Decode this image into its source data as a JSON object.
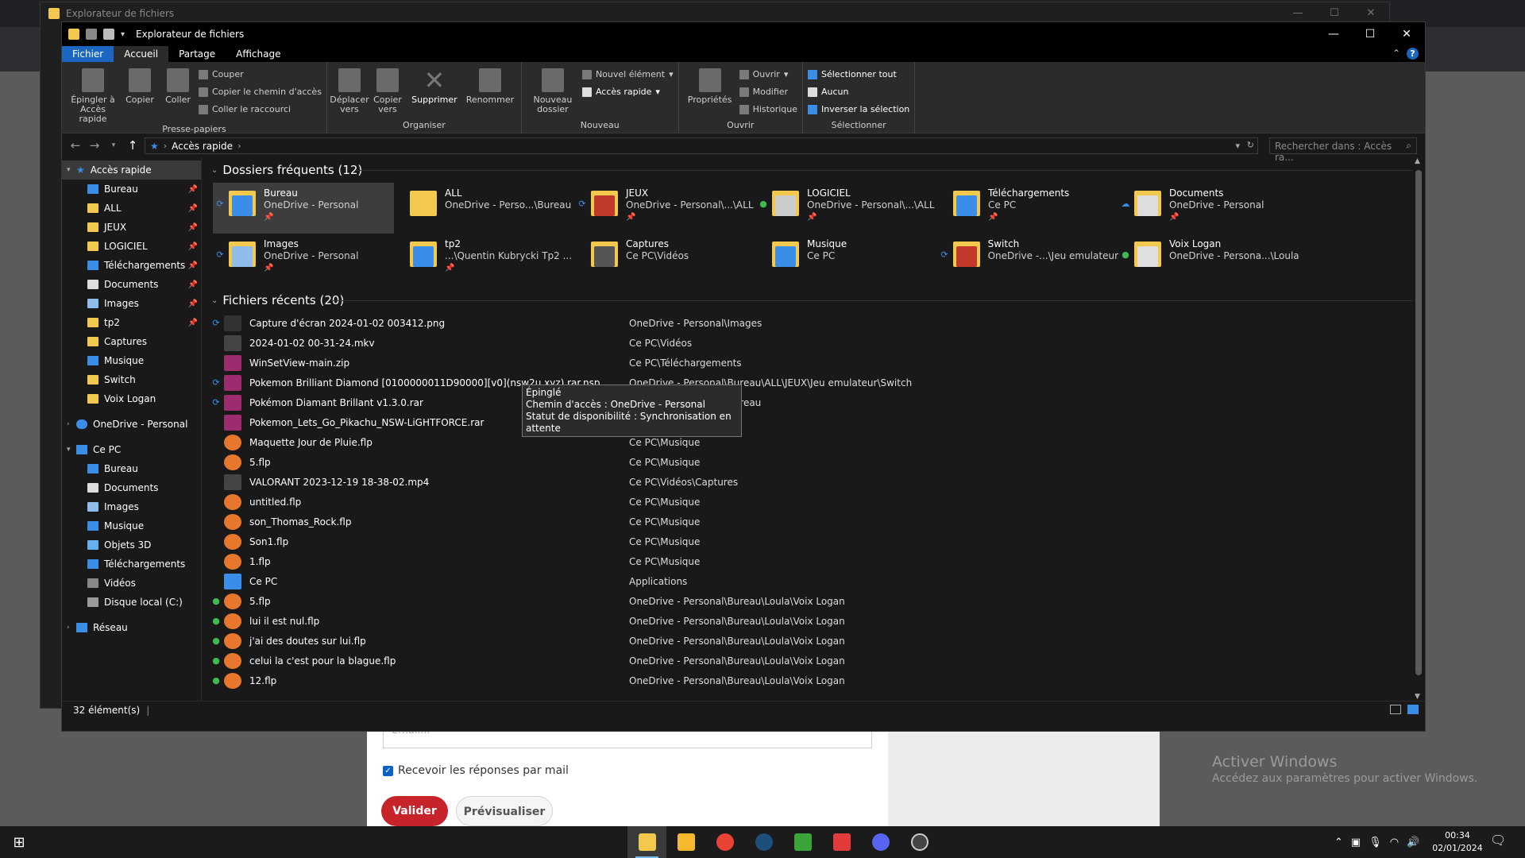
{
  "window": {
    "title": "Explorateur de fichiers",
    "minimize": "—",
    "maximize": "☐",
    "close": "✕"
  },
  "tabs": [
    {
      "label": "Fichier"
    },
    {
      "label": "Accueil"
    },
    {
      "label": "Partage"
    },
    {
      "label": "Affichage"
    }
  ],
  "ribbon": {
    "pin_label": "Épingler à Accès rapide",
    "copy_label": "Copier",
    "paste_label": "Coller",
    "cut_label": "Couper",
    "copy_path_label": "Copier le chemin d'accès",
    "paste_shortcut_label": "Coller le raccourci",
    "clipboard_group": "Presse-papiers",
    "move_to_label": "Déplacer vers",
    "copy_to_label": "Copier vers",
    "delete_label": "Supprimer",
    "rename_label": "Renommer",
    "organize_group": "Organiser",
    "new_folder_label": "Nouveau dossier",
    "new_item_label": "Nouvel élément",
    "easy_access_label": "Accès rapide",
    "new_group": "Nouveau",
    "properties_label": "Propriétés",
    "open_label": "Ouvrir",
    "edit_label": "Modifier",
    "history_label": "Historique",
    "open_group": "Ouvrir",
    "select_all_label": "Sélectionner tout",
    "select_none_label": "Aucun",
    "invert_label": "Inverser la sélection",
    "select_group": "Sélectionner"
  },
  "address": {
    "crumb": "Accès rapide",
    "search_placeholder": "Rechercher dans : Accès ra..."
  },
  "sidebar": {
    "quick_access": "Accès rapide",
    "quick_items": [
      {
        "label": "Bureau",
        "pinned": true
      },
      {
        "label": "ALL",
        "pinned": true
      },
      {
        "label": "JEUX",
        "pinned": true
      },
      {
        "label": "LOGICIEL",
        "pinned": true
      },
      {
        "label": "Téléchargements",
        "pinned": true
      },
      {
        "label": "Documents",
        "pinned": true
      },
      {
        "label": "Images",
        "pinned": true
      },
      {
        "label": "tp2",
        "pinned": true
      },
      {
        "label": "Captures",
        "pinned": false
      },
      {
        "label": "Musique",
        "pinned": false
      },
      {
        "label": "Switch",
        "pinned": false
      },
      {
        "label": "Voix Logan",
        "pinned": false
      }
    ],
    "onedrive": "OneDrive - Personal",
    "this_pc": "Ce PC",
    "pc_items": [
      {
        "label": "Bureau"
      },
      {
        "label": "Documents"
      },
      {
        "label": "Images"
      },
      {
        "label": "Musique"
      },
      {
        "label": "Objets 3D"
      },
      {
        "label": "Téléchargements"
      },
      {
        "label": "Vidéos"
      },
      {
        "label": "Disque local (C:)"
      }
    ],
    "network": "Réseau"
  },
  "frequent": {
    "heading": "Dossiers fréquents (12)",
    "items": [
      {
        "name": "Bureau",
        "path": "OneDrive - Personal",
        "sync": "⟳",
        "pinned": "📌"
      },
      {
        "name": "ALL",
        "path": "OneDrive - Perso...\\Bureau",
        "sync": "",
        "pinned": ""
      },
      {
        "name": "JEUX",
        "path": "OneDrive - Personal\\...\\ALL",
        "sync": "⟳",
        "pinned": "📌"
      },
      {
        "name": "LOGICIEL",
        "path": "OneDrive - Personal\\...\\ALL",
        "sync": "●",
        "pinned": "📌"
      },
      {
        "name": "Téléchargements",
        "path": "Ce PC",
        "sync": "",
        "pinned": "📌"
      },
      {
        "name": "Documents",
        "path": "OneDrive - Personal",
        "sync": "☁",
        "pinned": "📌"
      },
      {
        "name": "Images",
        "path": "OneDrive - Personal",
        "sync": "⟳",
        "pinned": "📌"
      },
      {
        "name": "tp2",
        "path": "...\\Quentin Kubrycki Tp2 ...",
        "sync": "",
        "pinned": "📌"
      },
      {
        "name": "Captures",
        "path": "Ce PC\\Vidéos",
        "sync": "",
        "pinned": ""
      },
      {
        "name": "Musique",
        "path": "Ce PC",
        "sync": "",
        "pinned": ""
      },
      {
        "name": "Switch",
        "path": "OneDrive -...\\Jeu emulateur",
        "sync": "⟳",
        "pinned": ""
      },
      {
        "name": "Voix Logan",
        "path": "OneDrive - Persona...\\Loula",
        "sync": "●",
        "pinned": ""
      }
    ]
  },
  "tooltip": {
    "line1": "Épinglé",
    "line2": "Chemin d'accès : OneDrive - Personal",
    "line3": "Statut de disponibilité : Synchronisation en attente"
  },
  "recent": {
    "heading": "Fichiers récents (20)",
    "items": [
      {
        "name": "Capture d'écran 2024-01-02 003412.png",
        "path": "OneDrive - Personal\\Images",
        "sync": "⟳"
      },
      {
        "name": "2024-01-02 00-31-24.mkv",
        "path": "Ce PC\\Vidéos",
        "sync": ""
      },
      {
        "name": "WinSetView-main.zip",
        "path": "Ce PC\\Téléchargements",
        "sync": ""
      },
      {
        "name": "Pokemon Brilliant Diamond [0100000011D90000][v0](nsw2u.xyz).rar.nsp",
        "path": "OneDrive - Personal\\Bureau\\ALL\\JEUX\\Jeu emulateur\\Switch",
        "sync": "⟳"
      },
      {
        "name": "Pokémon Diamant Brillant v1.3.0.rar",
        "path": "OneDrive - Personal\\Bureau",
        "sync": "⟳"
      },
      {
        "name": "Pokemon_Lets_Go_Pikachu_NSW-LiGHTFORCE.rar",
        "path": "Ce PC\\Téléchargements",
        "sync": ""
      },
      {
        "name": "Maquette Jour de Pluie.flp",
        "path": "Ce PC\\Musique",
        "sync": ""
      },
      {
        "name": "5.flp",
        "path": "Ce PC\\Musique",
        "sync": ""
      },
      {
        "name": "VALORANT   2023-12-19 18-38-02.mp4",
        "path": "Ce PC\\Vidéos\\Captures",
        "sync": ""
      },
      {
        "name": "untitled.flp",
        "path": "Ce PC\\Musique",
        "sync": ""
      },
      {
        "name": "son_Thomas_Rock.flp",
        "path": "Ce PC\\Musique",
        "sync": ""
      },
      {
        "name": "Son1.flp",
        "path": "Ce PC\\Musique",
        "sync": ""
      },
      {
        "name": "1.flp",
        "path": "Ce PC\\Musique",
        "sync": ""
      },
      {
        "name": "Ce PC",
        "path": "Applications",
        "sync": ""
      },
      {
        "name": "5.flp",
        "path": "OneDrive - Personal\\Bureau\\Loula\\Voix Logan",
        "sync": "●"
      },
      {
        "name": "lui il est nul.flp",
        "path": "OneDrive - Personal\\Bureau\\Loula\\Voix Logan",
        "sync": "●"
      },
      {
        "name": "j'ai des doutes sur lui.flp",
        "path": "OneDrive - Personal\\Bureau\\Loula\\Voix Logan",
        "sync": "●"
      },
      {
        "name": "celui la c'est pour la blague.flp",
        "path": "OneDrive - Personal\\Bureau\\Loula\\Voix Logan",
        "sync": "●"
      },
      {
        "name": "12.flp",
        "path": "OneDrive - Personal\\Bureau\\Loula\\Voix Logan",
        "sync": "●"
      }
    ]
  },
  "status": {
    "count": "32 élément(s)"
  },
  "background": {
    "email_placeholder": "Email...",
    "checkbox_label": "Recevoir les réponses par mail",
    "submit_label": "Valider",
    "preview_label": "Prévisualiser",
    "activate_title": "Activer Windows",
    "activate_sub": "Accédez aux paramètres pour activer Windows."
  },
  "taskbar": {
    "time": "00:34",
    "date": "02/01/2024"
  },
  "colors": {
    "accent": "#1a66c2",
    "folder": "#f2c94c",
    "sync_green": "#3fb950",
    "sync_blue": "#3a8ee8"
  }
}
